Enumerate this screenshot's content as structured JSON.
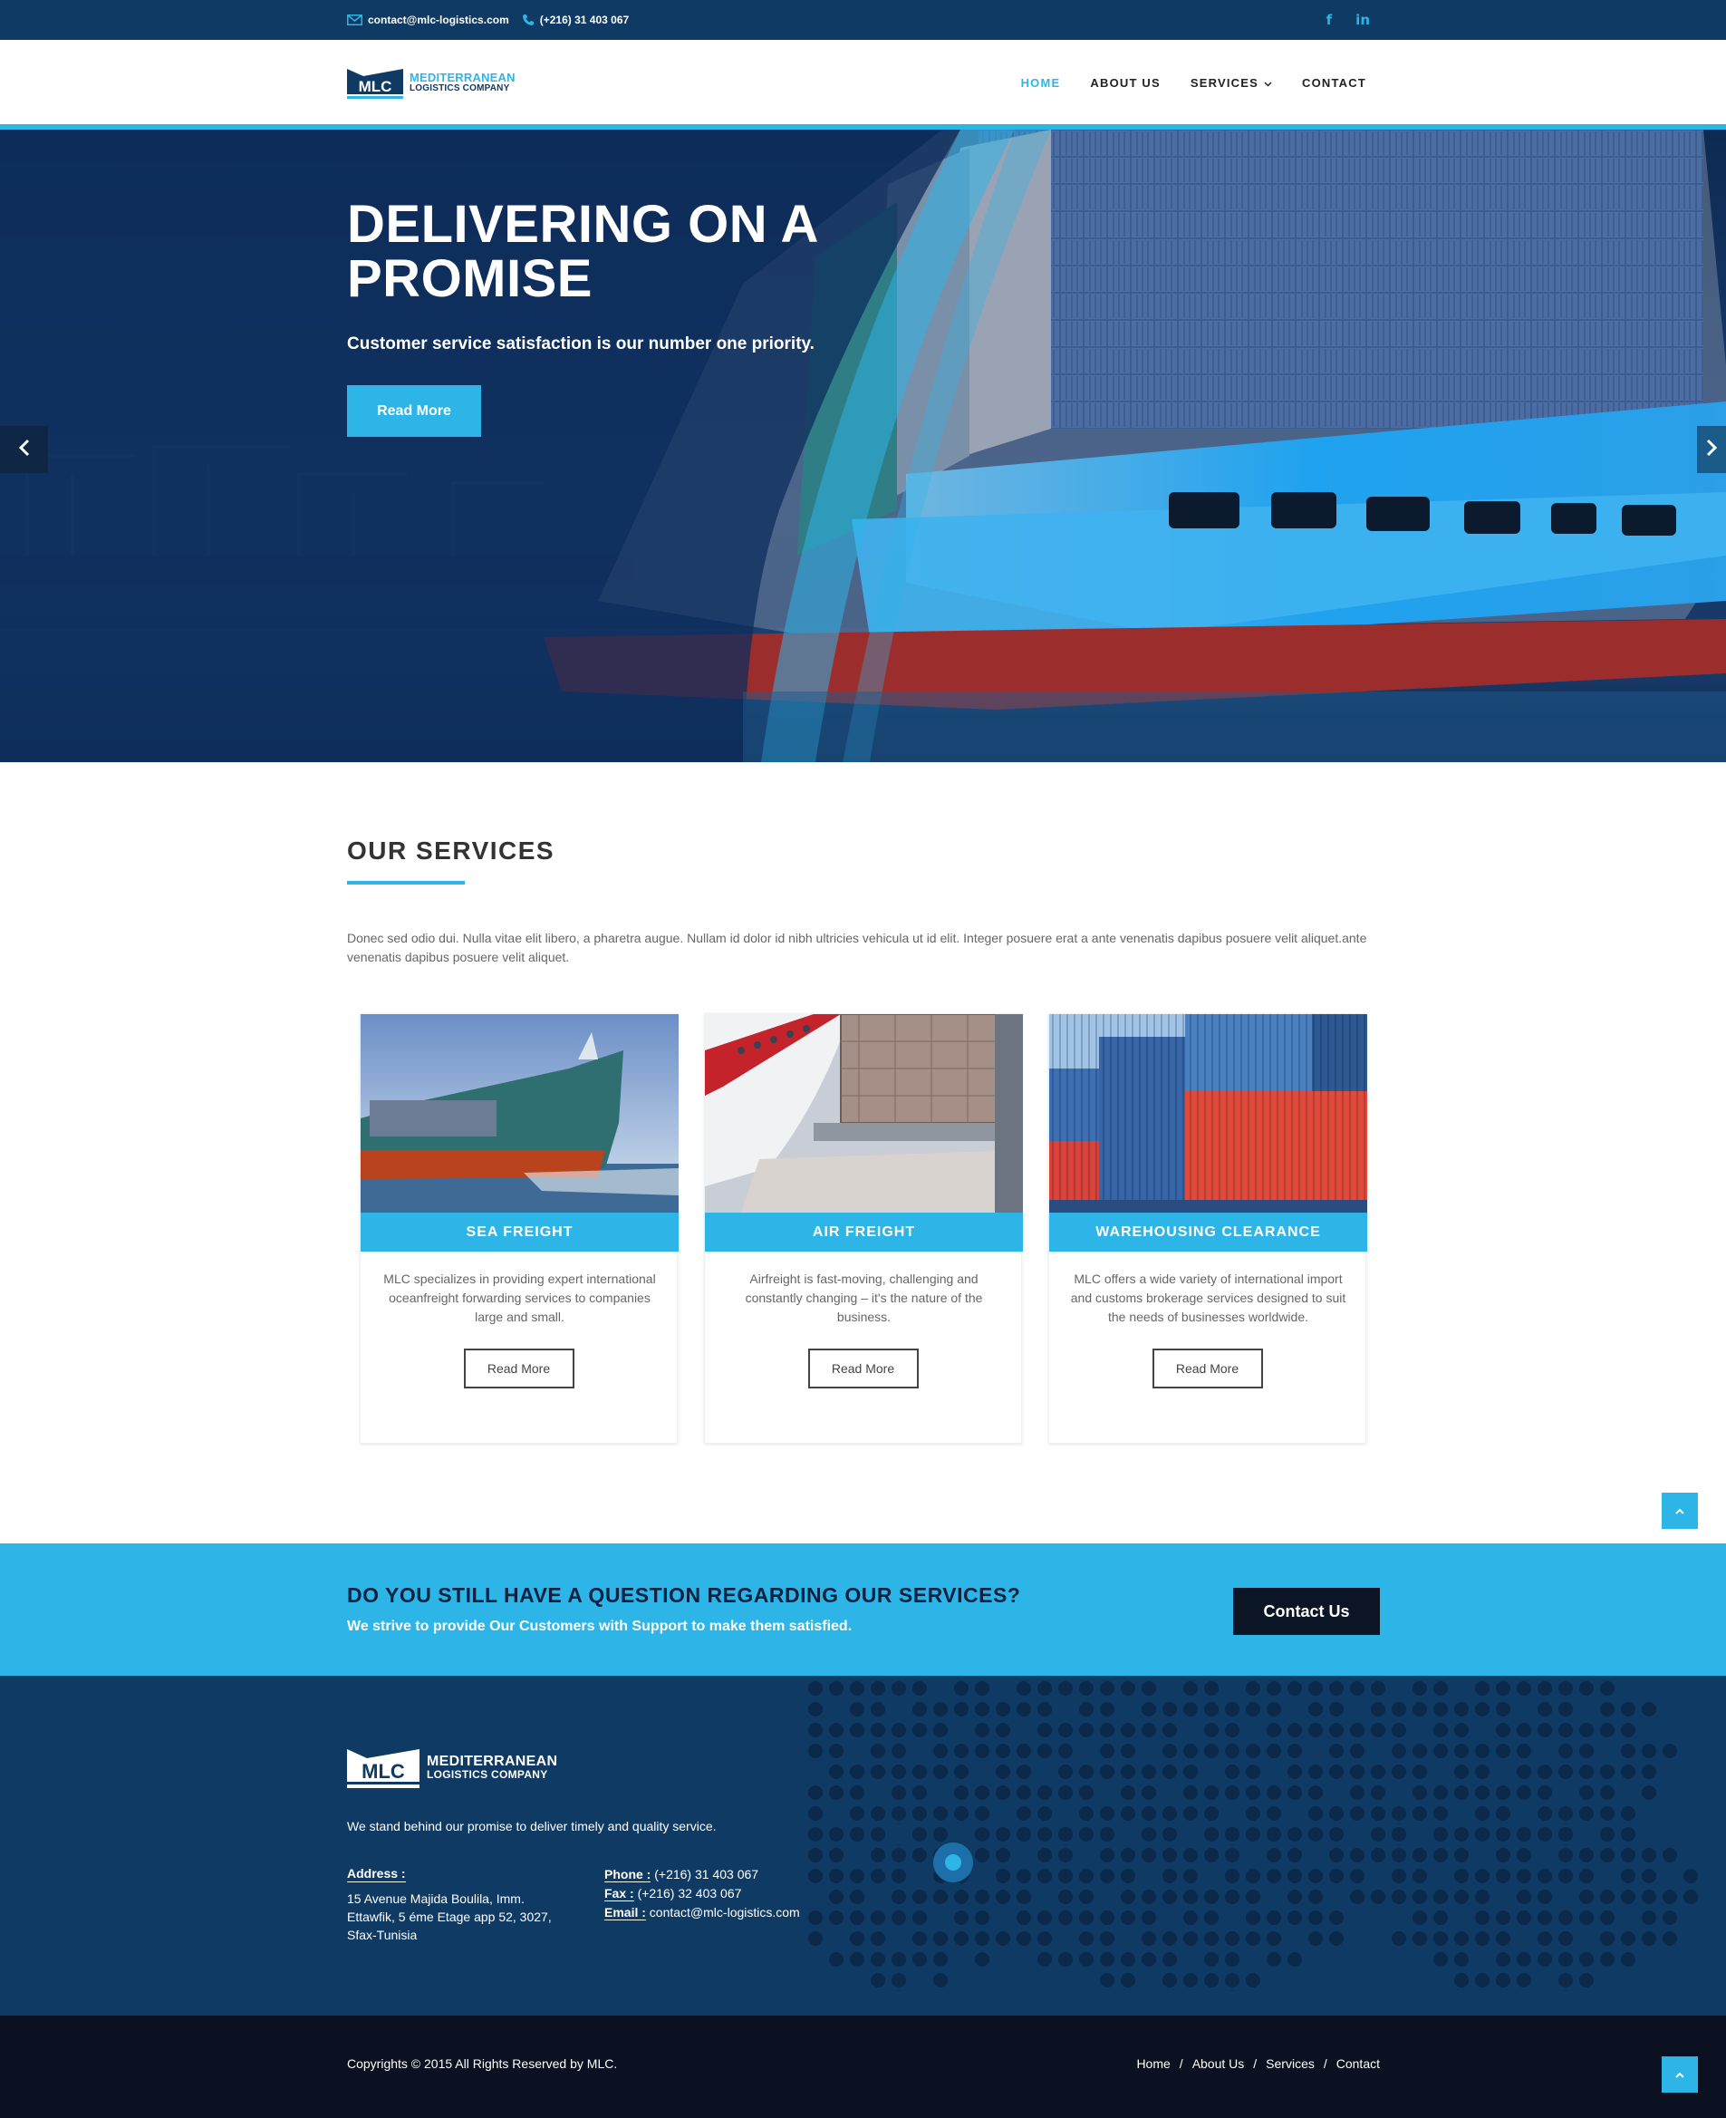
{
  "topbar": {
    "email": "contact@mlc-logistics.com",
    "phone": "(+216) 31 403 067",
    "social": [
      "f",
      "in"
    ]
  },
  "brand": {
    "mark": "MLC",
    "line1": "MEDITERRANEAN",
    "line2": "LOGISTICS COMPANY"
  },
  "nav": {
    "items": [
      {
        "label": "HOME",
        "active": true
      },
      {
        "label": "ABOUT US"
      },
      {
        "label": "SERVICES",
        "dropdown": true
      },
      {
        "label": "CONTACT"
      }
    ]
  },
  "hero": {
    "title": "DELIVERING ON A PROMISE",
    "subtitle": "Customer service satisfaction is our number one priority.",
    "button": "Read More"
  },
  "services": {
    "title": "OUR SERVICES",
    "description": "Donec sed odio dui. Nulla vitae elit libero, a pharetra augue. Nullam id dolor id nibh ultricies vehicula ut id elit. Integer posuere erat a ante venenatis dapibus posuere velit aliquet.ante venenatis dapibus posuere velit aliquet.",
    "cards": [
      {
        "title": "SEA FREIGHT",
        "text": "MLC specializes in providing expert international oceanfreight forwarding services to companies large and small.",
        "button": "Read More"
      },
      {
        "title": "AIR FREIGHT",
        "text": "Airfreight is fast-moving, challenging and constantly changing – it's the nature of the business.",
        "button": "Read More"
      },
      {
        "title": "WAREHOUSING CLEARANCE",
        "text": "MLC offers a wide variety of international import and customs brokerage services designed to suit the needs of businesses worldwide.",
        "button": "Read More"
      }
    ]
  },
  "cta": {
    "title": "DO YOU STILL HAVE A QUESTION REGARDING OUR SERVICES?",
    "subtitle": "We strive to provide Our Customers with Support to make them satisfied.",
    "button": "Contact Us"
  },
  "footer": {
    "tagline": "We stand behind our promise to deliver timely and quality service.",
    "address_label": "Address :",
    "address_lines": [
      "15 Avenue Majida Boulila, Imm.",
      "Ettawfik, 5 éme Etage app 52, 3027,",
      "Sfax-Tunisia"
    ],
    "phone_label": "Phone :",
    "phone": " (+216) 31 403 067",
    "fax_label": "Fax :",
    "fax": " (+216) 32 403 067",
    "email_label": "Email :",
    "email": " contact@mlc-logistics.com",
    "copyright": "Copyrights © 2015 All Rights Reserved by MLC.",
    "links": [
      "Home",
      "About Us",
      "Services",
      "Contact"
    ],
    "separator": "/"
  },
  "colors": {
    "accent": "#2db5e8",
    "navy": "#0f3a63",
    "dark": "#0c1121"
  }
}
